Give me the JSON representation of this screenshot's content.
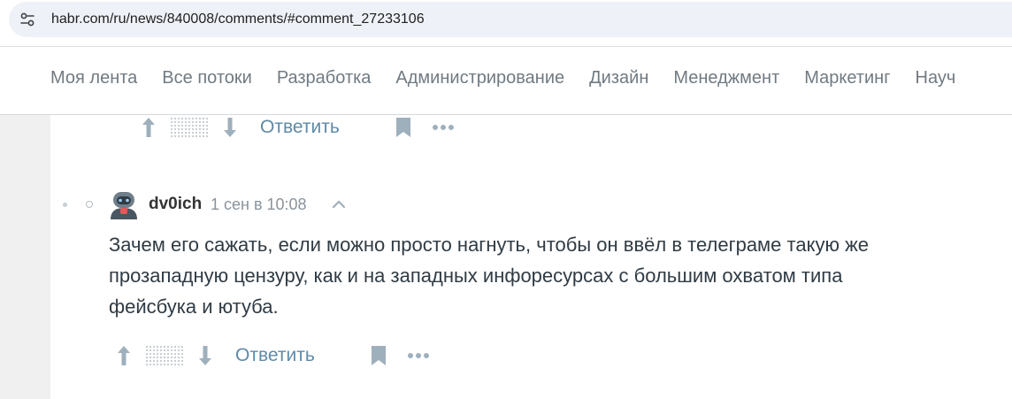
{
  "browser": {
    "url": "habr.com/ru/news/840008/comments/#comment_27233106",
    "site_icon": "tune-icon"
  },
  "nav": {
    "items": [
      {
        "label": "Моя лента"
      },
      {
        "label": "Все потоки"
      },
      {
        "label": "Разработка"
      },
      {
        "label": "Администрирование"
      },
      {
        "label": "Дизайн"
      },
      {
        "label": "Менеджмент"
      },
      {
        "label": "Маркетинг"
      },
      {
        "label": "Науч"
      }
    ]
  },
  "prev_comment": {
    "actions": {
      "reply_label": "Ответить"
    }
  },
  "comment": {
    "username": "dv0ich",
    "timestamp": "1 сен в 10:08",
    "text": "Зачем его сажать, если можно просто нагнуть, чтобы он ввёл в телеграме такую же прозападную цензуру, как и на западных инфоресурсах с большим охватом типа фейсбука и ютуба.",
    "actions": {
      "reply_label": "Ответить"
    }
  },
  "colors": {
    "link": "#5e8aa8",
    "nav_text": "#707a82",
    "icon_gray": "#9fb0bd",
    "page_bg": "#f0f0f0"
  }
}
